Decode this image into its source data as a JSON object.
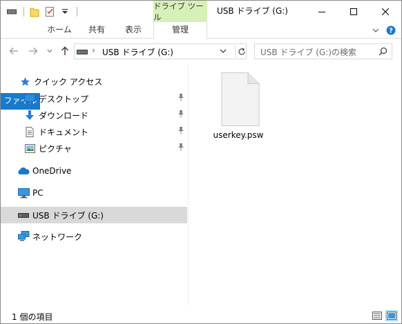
{
  "titlebar": {
    "context_tab_title": "ドライブ ツール",
    "window_title": "USB ドライブ (G:)"
  },
  "ribbon": {
    "tabs": {
      "file": "ファイル",
      "home": "ホーム",
      "share": "共有",
      "view": "表示",
      "manage": "管理"
    }
  },
  "address": {
    "path": "USB ドライブ (G:)"
  },
  "search": {
    "placeholder": "USB ドライブ (G:)の検索"
  },
  "nav": {
    "quick_access": "クイック アクセス",
    "desktop": "デスクトップ",
    "downloads": "ダウンロード",
    "documents": "ドキュメント",
    "pictures": "ピクチャ",
    "onedrive": "OneDrive",
    "pc": "PC",
    "usb": "USB ドライブ (G:)",
    "network": "ネットワーク"
  },
  "content": {
    "files": [
      {
        "name": "userkey.psw",
        "icon": "generic-file-icon"
      }
    ]
  },
  "status": {
    "item_count": "1 個の項目"
  },
  "colors": {
    "file_tab": "#1979ca",
    "context_tab": "#d6f0b7",
    "selection": "#d9d9d9",
    "view_active": "#cce8ff"
  }
}
